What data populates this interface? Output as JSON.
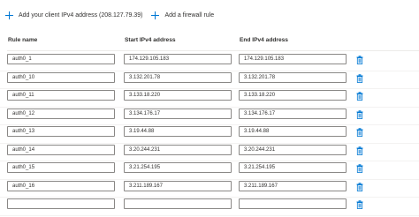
{
  "toolbar": {
    "add_client_ip_label": "Add your client IPv4 address (208.127.79.39)",
    "add_rule_label": "Add a firewall rule"
  },
  "columns": {
    "rule_name": "Rule name",
    "start_ip": "Start IPv4 address",
    "end_ip": "End IPv4 address"
  },
  "rules": [
    {
      "name": "auth0_1",
      "start": "174.129.105.183",
      "end": "174.129.105.183"
    },
    {
      "name": "auth0_10",
      "start": "3.132.201.78",
      "end": "3.132.201.78"
    },
    {
      "name": "auth0_11",
      "start": "3.133.18.220",
      "end": "3.133.18.220"
    },
    {
      "name": "auth0_12",
      "start": "3.134.176.17",
      "end": "3.134.176.17"
    },
    {
      "name": "auth0_13",
      "start": "3.19.44.88",
      "end": "3.19.44.88"
    },
    {
      "name": "auth0_14",
      "start": "3.20.244.231",
      "end": "3.20.244.231"
    },
    {
      "name": "auth0_15",
      "start": "3.21.254.195",
      "end": "3.21.254.195"
    },
    {
      "name": "auth0_16",
      "start": "3.211.189.167",
      "end": "3.211.189.167"
    },
    {
      "name": "",
      "start": "",
      "end": ""
    }
  ],
  "colors": {
    "accent": "#0078d4",
    "border": "#8a8886"
  }
}
